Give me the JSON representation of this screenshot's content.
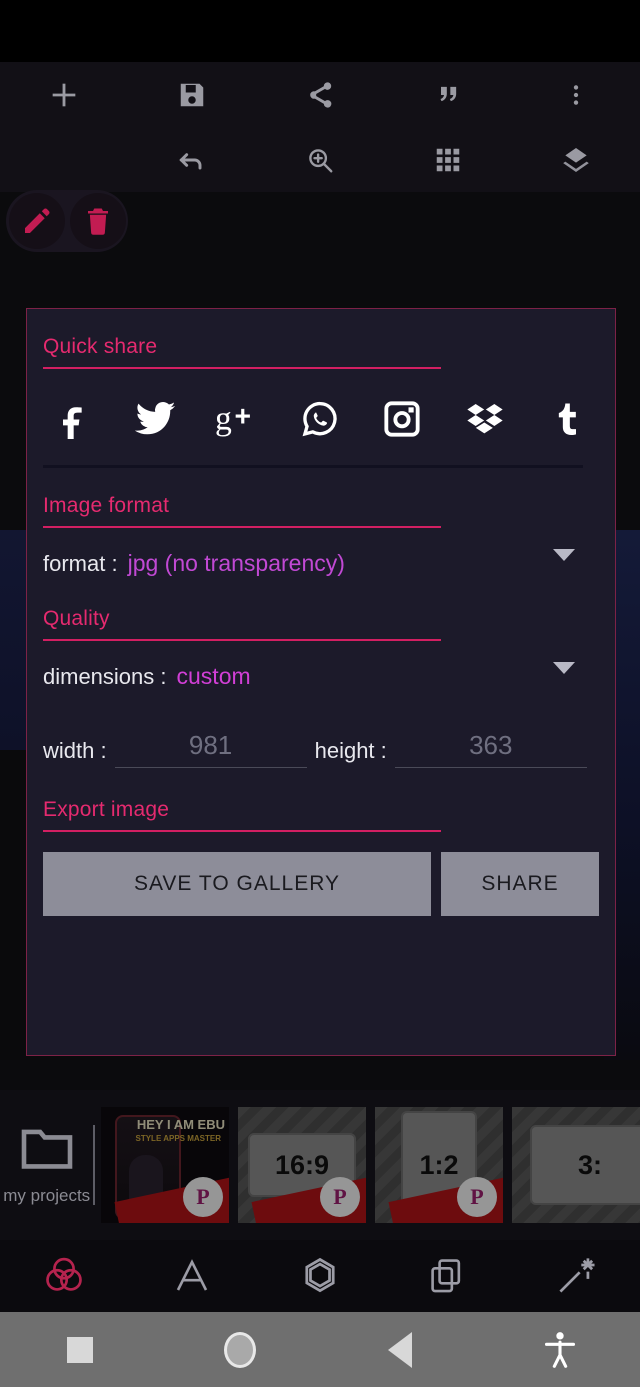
{
  "topbar": {
    "row1": [
      {
        "name": "add-icon",
        "label": "add"
      },
      {
        "name": "save-icon",
        "label": "save"
      },
      {
        "name": "share-icon",
        "label": "share"
      },
      {
        "name": "quote-icon",
        "label": "quote"
      },
      {
        "name": "overflow-menu-icon",
        "label": "more options"
      }
    ],
    "row2": [
      {
        "name": "edit-icon",
        "label": "edit"
      },
      {
        "name": "delete-icon",
        "label": "delete"
      },
      {
        "name": "undo-icon",
        "label": "undo"
      },
      {
        "name": "zoom-icon",
        "label": "zoom"
      },
      {
        "name": "grid-icon",
        "label": "grid"
      },
      {
        "name": "layers-icon",
        "label": "layers"
      }
    ]
  },
  "dialog": {
    "quick_share": {
      "title": "Quick share",
      "targets": [
        {
          "name": "facebook-icon",
          "label": "Facebook"
        },
        {
          "name": "twitter-icon",
          "label": "Twitter"
        },
        {
          "name": "google-plus-icon",
          "label": "Google+"
        },
        {
          "name": "whatsapp-icon",
          "label": "WhatsApp"
        },
        {
          "name": "instagram-icon",
          "label": "Instagram"
        },
        {
          "name": "dropbox-icon",
          "label": "Dropbox"
        },
        {
          "name": "tumblr-icon",
          "label": "Tumblr"
        }
      ]
    },
    "image_format": {
      "title": "Image format",
      "format_label": "format :",
      "format_value": "jpg (no transparency)"
    },
    "quality": {
      "title": "Quality",
      "dimensions_label": "dimensions :",
      "dimensions_value": "custom",
      "width_label": "width :",
      "width_placeholder": "981",
      "width_value": "",
      "height_label": "height :",
      "height_placeholder": "363",
      "height_value": ""
    },
    "export": {
      "title": "Export image",
      "save_label": "SAVE TO GALLERY",
      "share_label": "SHARE"
    },
    "colors": {
      "accent": "#e52a6f",
      "underline": "#d21f62",
      "value_text": "#c149d4",
      "panel_bg": "#1c1a2a",
      "button_bg": "#8d8d99"
    }
  },
  "projects": {
    "my_projects_label": "my projects",
    "folder_icon": "folder-icon",
    "thumbs": [
      {
        "name": "project-thumb-artwork",
        "label": "HEY I AM EBU",
        "sub": "STYLE APPS MASTER",
        "ratio": ""
      },
      {
        "name": "project-thumb-16-9",
        "label": "",
        "sub": "",
        "ratio": "16:9"
      },
      {
        "name": "project-thumb-1-2",
        "label": "",
        "sub": "",
        "ratio": "1:2"
      },
      {
        "name": "project-thumb-3-x",
        "label": "",
        "sub": "",
        "ratio": "3:"
      }
    ],
    "badge_text": "P"
  },
  "tabbar": [
    {
      "name": "tab-color-blend",
      "label": "color",
      "active": true
    },
    {
      "name": "tab-text",
      "label": "A",
      "active": false
    },
    {
      "name": "tab-shape",
      "label": "shape",
      "active": false
    },
    {
      "name": "tab-layers",
      "label": "layers",
      "active": false
    },
    {
      "name": "tab-effects",
      "label": "effects",
      "active": false
    }
  ],
  "navbar": [
    {
      "name": "nav-recents-button",
      "label": "recents"
    },
    {
      "name": "nav-home-button",
      "label": "home"
    },
    {
      "name": "nav-back-button",
      "label": "back"
    },
    {
      "name": "nav-accessibility-button",
      "label": "accessibility"
    }
  ]
}
